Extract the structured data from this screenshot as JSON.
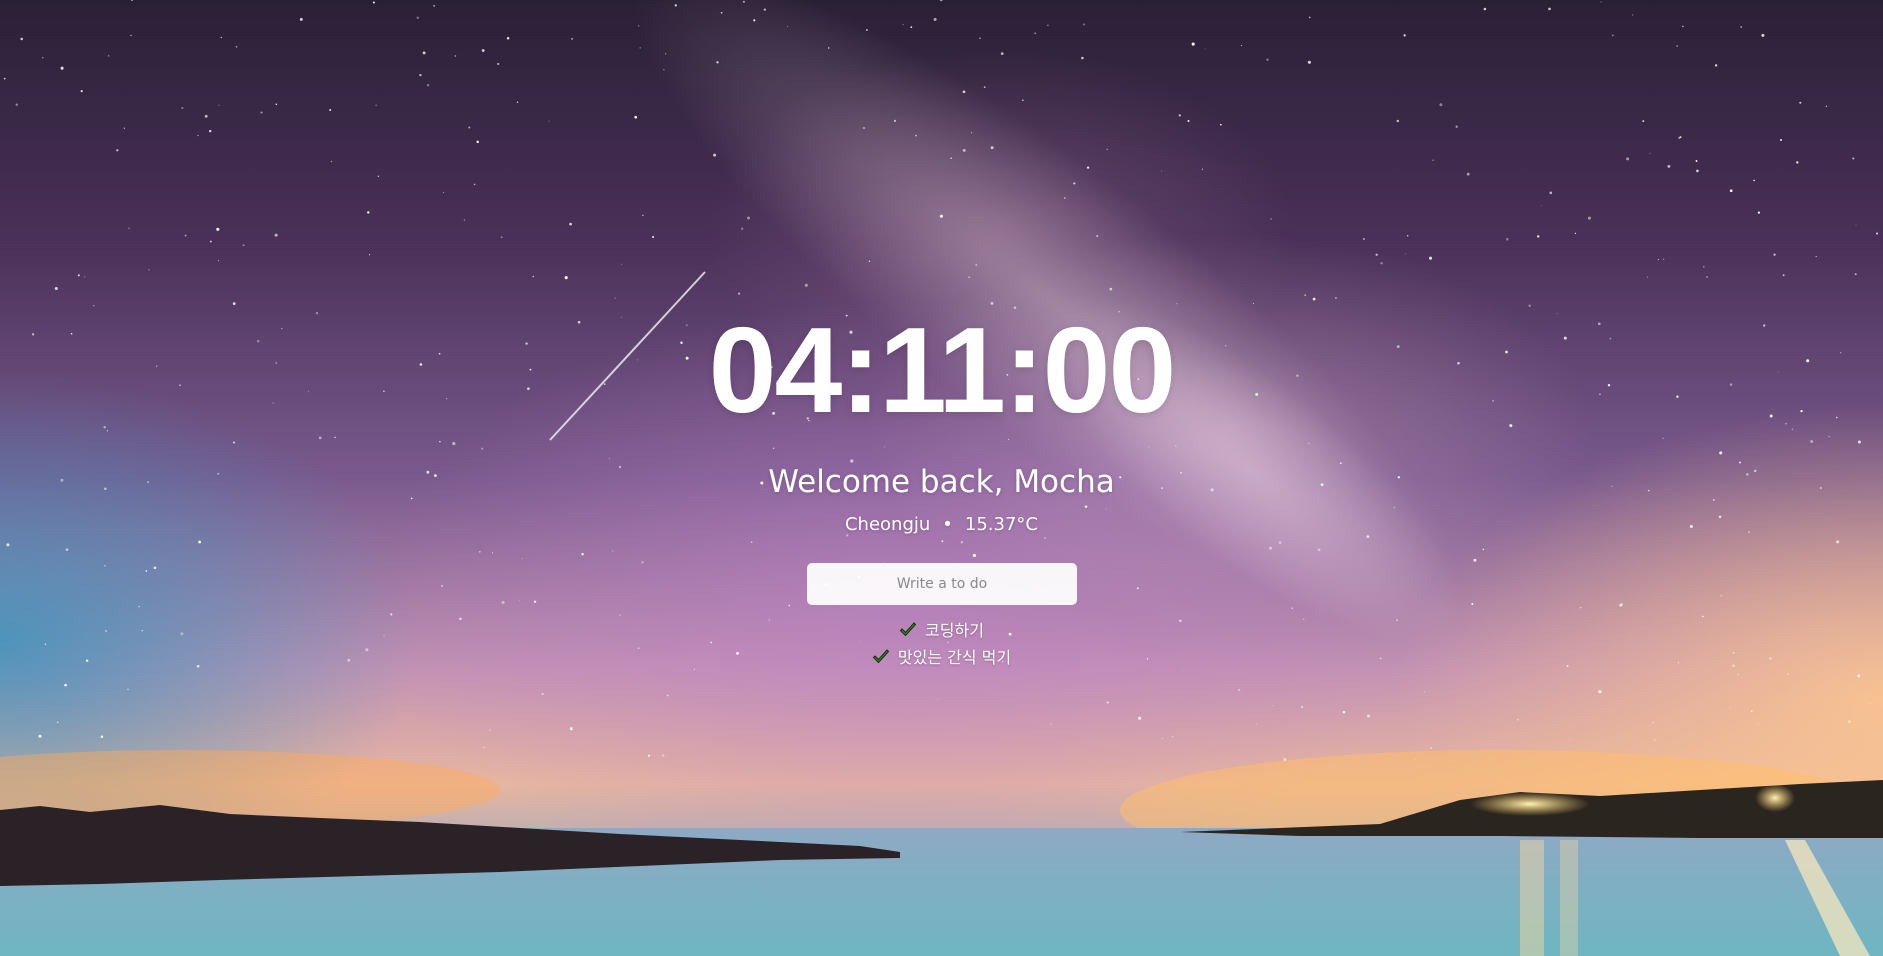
{
  "clock": {
    "time": "04:11:00"
  },
  "greeting": {
    "text": "Welcome back, Mocha"
  },
  "weather": {
    "city": "Cheongju",
    "separator": "•",
    "temperature": "15.37°C"
  },
  "todo_form": {
    "placeholder": "Write a to do"
  },
  "todos": [
    {
      "text": "코딩하기",
      "icon": "check-icon"
    },
    {
      "text": "맛있는 간식 먹기",
      "icon": "check-icon"
    }
  ],
  "colors": {
    "check_fill": "#3a8a2e",
    "check_stroke": "#10300c",
    "input_background": "#f2f2f2"
  }
}
